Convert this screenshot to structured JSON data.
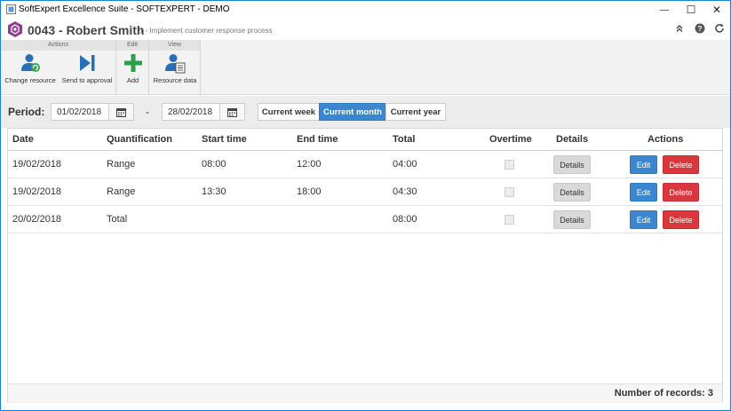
{
  "window": {
    "title": "SoftExpert Excellence Suite - SOFTEXPERT - DEMO",
    "minimize_glyph": "—",
    "maximize_glyph": "☐",
    "close_glyph": "✕"
  },
  "header": {
    "record_title": "0043 - Robert Smith",
    "separator": "|",
    "subtitle": "1 - Implement customer response process",
    "icons": [
      "collapse-icon",
      "help-icon",
      "refresh-icon"
    ]
  },
  "ribbon": {
    "groups": [
      {
        "label": "Actions",
        "buttons": [
          {
            "label": "Change resource",
            "icon": "change-resource-icon"
          },
          {
            "label": "Send to approval",
            "icon": "send-approval-icon"
          }
        ]
      },
      {
        "label": "Edit",
        "buttons": [
          {
            "label": "Add",
            "icon": "add-icon"
          }
        ]
      },
      {
        "label": "View",
        "buttons": [
          {
            "label": "Resource data",
            "icon": "resource-data-icon"
          }
        ]
      }
    ]
  },
  "period": {
    "label": "Period:",
    "start": "01/02/2018",
    "end": "28/02/2018",
    "dash": "-",
    "ranges": [
      {
        "label": "Current week",
        "active": false
      },
      {
        "label": "Current month",
        "active": true
      },
      {
        "label": "Current year",
        "active": false
      }
    ]
  },
  "grid": {
    "columns": [
      "Date",
      "Quantification",
      "Start time",
      "End time",
      "Total",
      "Overtime",
      "Details",
      "Actions"
    ],
    "rows": [
      {
        "date": "19/02/2018",
        "quantification": "Range",
        "start": "08:00",
        "end": "12:00",
        "total": "04:00",
        "overtime": false
      },
      {
        "date": "19/02/2018",
        "quantification": "Range",
        "start": "13:30",
        "end": "18:00",
        "total": "04:30",
        "overtime": false
      },
      {
        "date": "20/02/2018",
        "quantification": "Total",
        "start": "",
        "end": "",
        "total": "08:00",
        "overtime": false
      }
    ],
    "details_label": "Details",
    "edit_label": "Edit",
    "delete_label": "Delete",
    "footer": "Number of records: 3"
  },
  "colors": {
    "accent": "#3a87cf",
    "danger": "#d9363e",
    "window_border": "#1883d7",
    "add_green": "#2e9e4e"
  }
}
